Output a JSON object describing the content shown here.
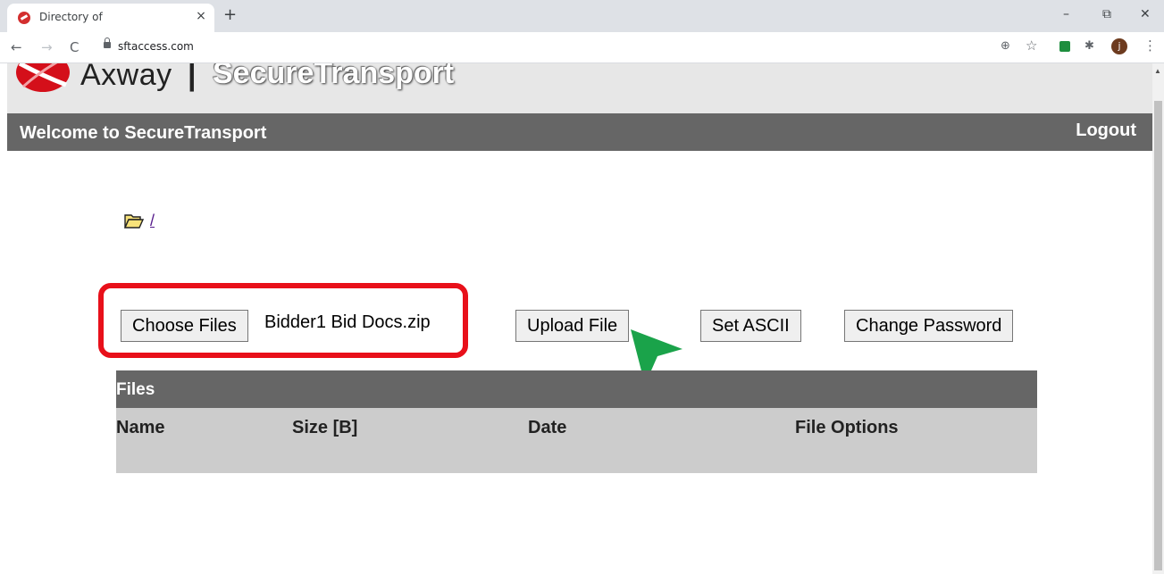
{
  "browser": {
    "tab_title": "Directory of",
    "tab_close": "×",
    "new_tab": "+",
    "url": "sftaccess.com",
    "nav": {
      "back": "←",
      "forward": "→",
      "reload": "C"
    },
    "toolbar_icons": {
      "zoom": "⊕",
      "bookmark": "☆",
      "puzzle": "✱",
      "menu": "⋮"
    },
    "avatar_letter": "j",
    "window": {
      "minimize": "–",
      "restore": "⧉",
      "close": "✕"
    }
  },
  "header": {
    "brand_axway": "Axway",
    "brand_separator": "|",
    "brand_product": "SecureTransport",
    "welcome": "Welcome to SecureTransport",
    "logout": "Logout"
  },
  "directory": {
    "path_link": "/"
  },
  "actions": {
    "choose_files": "Choose Files",
    "selected_file": "Bidder1 Bid Docs.zip",
    "upload": "Upload File",
    "set_ascii": "Set ASCII",
    "change_password": "Change Password"
  },
  "files": {
    "title": "Files",
    "columns": [
      "Name",
      "Size [B]",
      "Date",
      "File Options"
    ]
  },
  "colors": {
    "highlight_border": "#e8101a",
    "cursor_arrow": "#1aa34a",
    "bar_gray": "#666666",
    "table_gray": "#cccccc",
    "banner_gray": "#e7e7e7"
  }
}
